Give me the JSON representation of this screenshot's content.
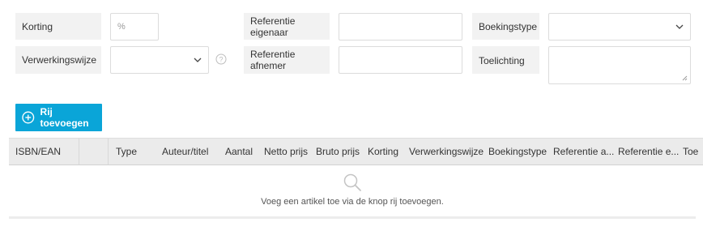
{
  "form": {
    "korting": {
      "label": "Korting",
      "placeholder": "%"
    },
    "verwerkingswijze": {
      "label": "Verwerkingswijze",
      "value": "",
      "help_icon": "question-circle"
    },
    "referentie_eigenaar": {
      "label": "Referentie eigenaar",
      "value": ""
    },
    "referentie_afnemer": {
      "label": "Referentie afnemer",
      "value": ""
    },
    "boekingstype": {
      "label": "Boekingstype",
      "value": ""
    },
    "toelichting": {
      "label": "Toelichting",
      "value": ""
    }
  },
  "actions": {
    "add_row_label": "Rij toevoegen",
    "add_row_icon": "plus-circle",
    "accent_color": "#0aa5d8"
  },
  "table": {
    "columns": [
      "ISBN/EAN",
      "",
      "Type",
      "Auteur/titel",
      "Aantal",
      "Netto prijs",
      "Bruto prijs",
      "Korting",
      "Verwerkingswijze",
      "Boekingstype",
      "Referentie a...",
      "Referentie e...",
      "Toe"
    ],
    "empty_icon": "search",
    "empty_message": "Voeg een artikel toe via de knop rij toevoegen."
  }
}
